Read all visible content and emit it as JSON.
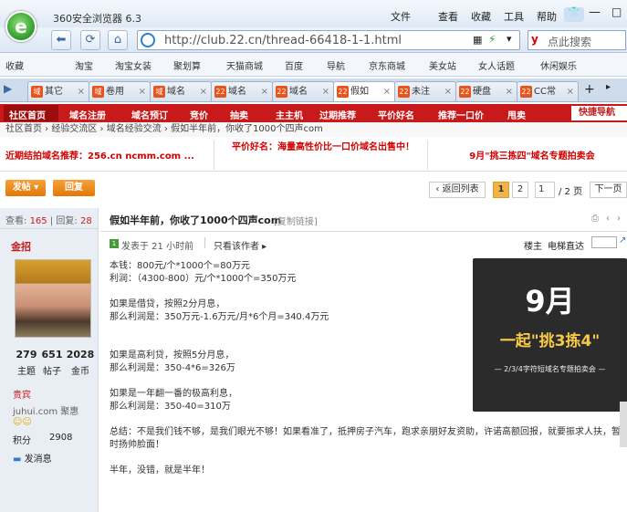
{
  "browser": {
    "app_name": "360安全浏览器 6.3",
    "menus": [
      "文件",
      "查看",
      "收藏",
      "工具",
      "帮助"
    ],
    "address": "http://club.22.cn/thread-66418-1-1.html",
    "search_placeholder": "点此搜索"
  },
  "favorites": [
    "收藏",
    "淘宝",
    "淘宝女装",
    "聚划算",
    "天猫商城",
    "百度",
    "导航",
    "京东商城",
    "美女站",
    "女人话题",
    "休闲娱乐"
  ],
  "tabs": [
    "其它",
    "卷用",
    "域名",
    "域名",
    "域名",
    "假如",
    "未注",
    "硬盘",
    "CC常"
  ],
  "site": {
    "nav": [
      "社区首页",
      "域名注册",
      "域名预订",
      "竞价",
      "抽卖",
      "主主机",
      "过期推荐",
      "平价好名",
      "推荐一口价",
      "甩卖"
    ],
    "quick": "快捷导航",
    "breadcrumb": "社区首页 › 经验交流区 › 域名经验交流 › 假如半年前，你收了1000个四声com",
    "promo": [
      "近期结拍域名推荐：256.cn ncmm.com ...",
      "平价好名：海量高性价比一口价域名出售中！",
      "9月\"挑三拣四\"域名专题拍卖会"
    ],
    "post_btn": "发帖",
    "reply_btn": "回复",
    "back": "返回列表",
    "pages": [
      "1",
      "2"
    ],
    "page_input": "1",
    "page_total": "/ 2 页",
    "next": "下一页"
  },
  "thread": {
    "views_label": "查看:",
    "views": "165",
    "replies_label": "回复:",
    "replies": "28",
    "title": "假如半年前，你收了1000个四声com",
    "copy_link": "[复制链接]",
    "posted": "发表于 21 小时前",
    "only_author": "只看该作者",
    "floor": "楼主",
    "jump": "电梯直达",
    "body": [
      "本钱：800元/个*1000个=80万元",
      "利润：（4300-800）元/个*1000个=350万元",
      "",
      "如果是借贷，按照2分月息，",
      "那么利润是：350万元-1.6万元/月*6个月=340.4万元",
      "",
      "",
      "如果是高利贷，按照5分月息，",
      "那么利润是：350-4*6=326万",
      "",
      "如果是一年翻一番的极高利息，",
      "那么利润是：350-40=310万",
      "",
      "总结：不是我们钱不够，是我们眼光不够！如果看准了，抵押房子汽车，跑求亲朋好友资助，许诺高额回报，就要振求人扶，暂时扬帅脸面！",
      "",
      "半年，没错，就是半年！"
    ]
  },
  "author": {
    "name": "金招",
    "stats": [
      {
        "v": "279",
        "l": "主题"
      },
      {
        "v": "651",
        "l": "帖子"
      },
      {
        "v": "2028",
        "l": "金币"
      }
    ],
    "group": "贵宾",
    "site": "juhui.com 聚惠",
    "score_label": "积分",
    "score": "2908",
    "msg": "发消息"
  },
  "ad": {
    "big": "9月",
    "mid": "一起\"挑3拣4\"",
    "sub": "— 2/3/4字符短域名专题拍卖会 —"
  }
}
